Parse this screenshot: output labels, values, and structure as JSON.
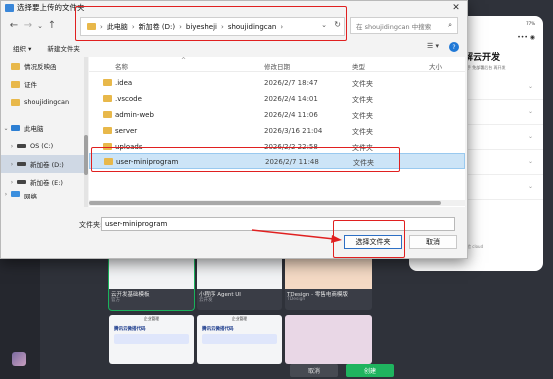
{
  "background": {
    "phone": {
      "status_time": "",
      "status_right": "77%",
      "quickstart": "快速 QuickStart",
      "title": "了解云开发",
      "subtitle": "快速上手 免部署后台 再开发",
      "footer": "服务体验 cloud"
    },
    "templates": [
      {
        "title": "云开发基础模板",
        "subtitle": "官方"
      },
      {
        "title": "小程序 Agent UI",
        "subtitle": "云开发"
      },
      {
        "title": "TDesign - 零售电商模版",
        "subtitle": "TDesign"
      }
    ],
    "bottom_cards": [
      {
        "bar": "企业管理",
        "head": "腾讯云微搭代码"
      },
      {
        "bar": "企业管理",
        "head": "腾讯云微搭代码"
      }
    ],
    "buttons": {
      "cancel": "取消",
      "create": "创建"
    }
  },
  "dialog": {
    "title": "选择要上传的文件夹",
    "close": "✕",
    "address": {
      "segments": [
        "此电脑",
        "新加卷 (D:)",
        "biyeshejі",
        "shoujidingcan"
      ],
      "separator": "›"
    },
    "search_placeholder": "在 shoujidingcan 中搜索",
    "toolbar": {
      "organize": "组织 ▾",
      "new_folder": "新建文件夹"
    },
    "sidebar": [
      {
        "label": "情况反映函",
        "icon": "folder-icon"
      },
      {
        "label": "证件",
        "icon": "folder-icon"
      },
      {
        "label": "shoujidingcan",
        "icon": "folder-icon"
      },
      {
        "label": "此电脑",
        "icon": "computer-icon"
      },
      {
        "label": "OS (C:)",
        "icon": "drive-icon"
      },
      {
        "label": "新加卷 (D:)",
        "icon": "drive-icon"
      },
      {
        "label": "新加卷 (E:)",
        "icon": "drive-icon"
      },
      {
        "label": "网络",
        "icon": "network-icon"
      }
    ],
    "columns": {
      "name": "名称",
      "date": "修改日期",
      "type": "类型",
      "size": "大小"
    },
    "files": [
      {
        "name": ".idea",
        "date": "2026/2/7 18:47",
        "type": "文件夹"
      },
      {
        "name": ".vscode",
        "date": "2026/2/4 14:01",
        "type": "文件夹"
      },
      {
        "name": "admin-web",
        "date": "2026/2/4 11:06",
        "type": "文件夹"
      },
      {
        "name": "server",
        "date": "2026/3/16 21:04",
        "type": "文件夹"
      },
      {
        "name": "uploads",
        "date": "2026/2/2 22:58",
        "type": "文件夹"
      },
      {
        "name": "user-miniprogram",
        "date": "2026/2/7 11:48",
        "type": "文件夹"
      }
    ],
    "filename_label": "文件夹:",
    "filename_value": "user-miniprogram",
    "select_button": "选择文件夹",
    "cancel_button": "取消"
  }
}
